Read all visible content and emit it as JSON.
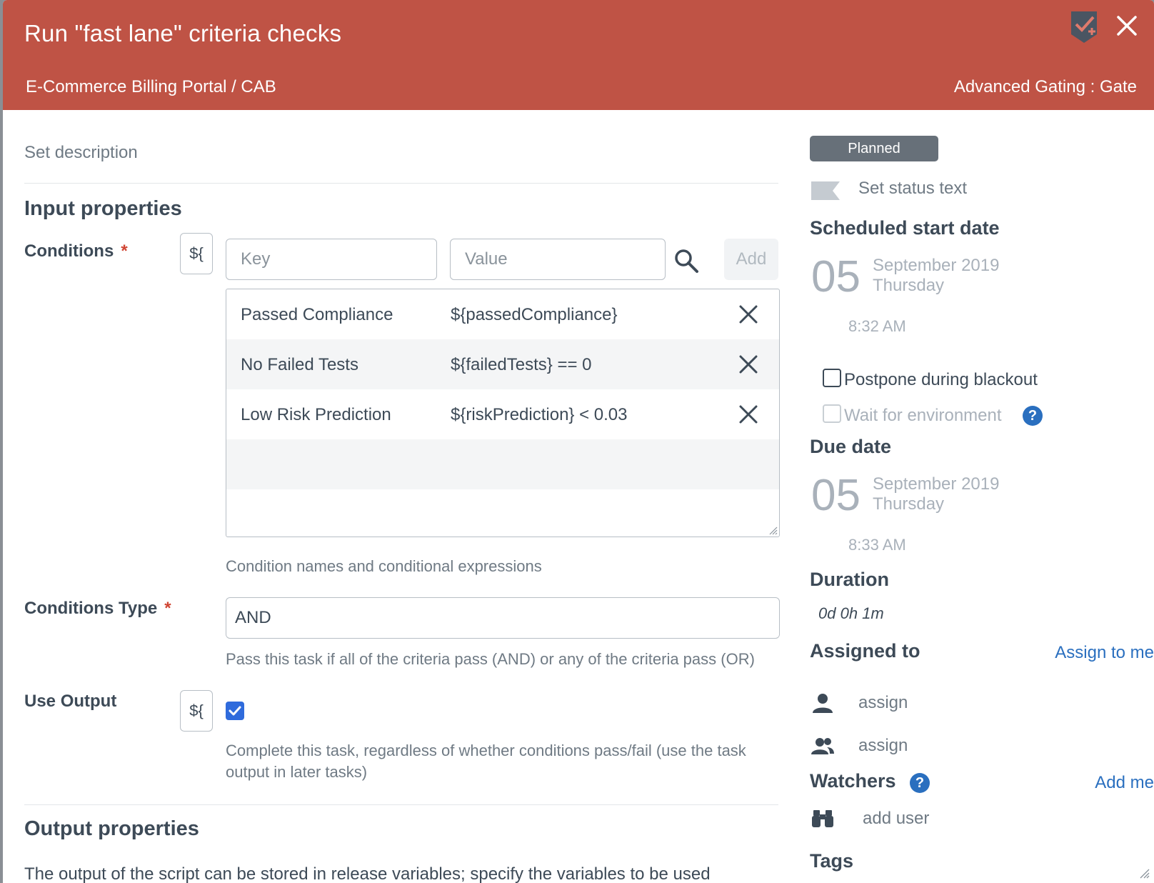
{
  "header": {
    "title": "Run \"fast lane\" criteria checks",
    "path": "E-Commerce Billing Portal / CAB",
    "phase": "Advanced Gating : Gate"
  },
  "left": {
    "set_description": "Set description",
    "input_properties_title": "Input properties",
    "conditions": {
      "label": "Conditions",
      "required": "*",
      "var_button": "${",
      "key_placeholder": "Key",
      "value_placeholder": "Value",
      "add_label": "Add",
      "rows": [
        {
          "key": "Passed Compliance",
          "value": "${passedCompliance}"
        },
        {
          "key": "No Failed Tests",
          "value": "${failedTests} == 0"
        },
        {
          "key": "Low Risk Prediction",
          "value": "${riskPrediction} < 0.03"
        }
      ],
      "help": "Condition names and conditional expressions"
    },
    "conditions_type": {
      "label": "Conditions Type",
      "required": "*",
      "value": "AND",
      "help": "Pass this task if all of the criteria pass (AND) or any of the criteria pass (OR)"
    },
    "use_output": {
      "label": "Use Output",
      "var_button": "${",
      "checked": true,
      "help_line1": "Complete this task, regardless of whether conditions pass/fail (use the task",
      "help_line2": "output in later tasks)"
    },
    "output_properties_title": "Output properties",
    "output_text": "The output of the script can be stored in release variables; specify the variables to be used"
  },
  "right": {
    "status": "Planned",
    "status_text": "Set status text",
    "scheduled_start": {
      "heading": "Scheduled start date",
      "day": "05",
      "month_year": "September 2019",
      "weekday": "Thursday",
      "time": "8:32 AM"
    },
    "postpone_blackout": "Postpone during blackout",
    "wait_environment": "Wait for environment",
    "due": {
      "heading": "Due date",
      "day": "05",
      "month_year": "September 2019",
      "weekday": "Thursday",
      "time": "8:33 AM"
    },
    "duration_heading": "Duration",
    "duration_value": "0d 0h 1m",
    "assigned_heading": "Assigned to",
    "assign_to_me": "Assign to me",
    "assign_user": "assign",
    "assign_team": "assign",
    "watchers_heading": "Watchers",
    "add_me": "Add me",
    "add_user": "add user",
    "tags_heading": "Tags",
    "help_mark": "?"
  },
  "colors": {
    "header_bg": "#bf5345",
    "status_pill": "#677079",
    "link": "#2a6fbf",
    "checkbox": "#2f6bdc",
    "required": "#d04533"
  },
  "icons": [
    "task-badge-icon",
    "close-icon",
    "search-icon",
    "remove-icon",
    "flag-icon",
    "user-icon",
    "team-icon",
    "binoculars-icon",
    "help-icon",
    "check-icon",
    "resize-grip-icon"
  ]
}
